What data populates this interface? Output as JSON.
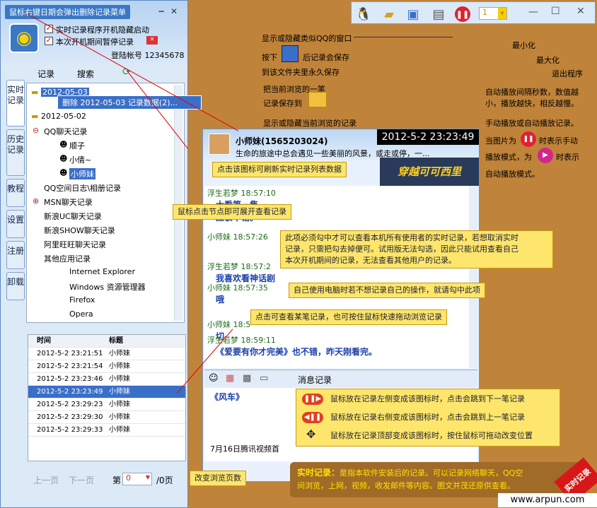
{
  "sidebar": {
    "tooltip_top": "鼠标右键日期会弹出删除记录菜单",
    "options": [
      "实时记录程序开机隐藏启动",
      "本次开机期间暂停记录"
    ],
    "account_label": "登陆帐号 12345678",
    "tabs_top": [
      "记录",
      "搜索"
    ],
    "tabs_side": [
      "实时记录",
      "历史记录",
      "教程",
      "设置",
      "注册",
      "卸载"
    ],
    "context_menu": "删除 2012-05-03 记录数据(2)...",
    "tree": {
      "date1": "2012-05-03",
      "date2": "2012-05-02",
      "qq": "QQ聊天记录",
      "qq_items": [
        "顺子",
        "小倩~",
        "小师妹"
      ],
      "qq_space": "QQ空间日志\\相册记录",
      "msn": "MSN聊天记录",
      "sina_uc": "新浪UC聊天记录",
      "sina_show": "新浪SHOW聊天记录",
      "aliww": "阿里旺旺聊天记录",
      "other": "其他应用记录",
      "other_items": [
        "Internet Explorer",
        "Windows 资源管理器",
        "Firefox",
        "Opera"
      ]
    },
    "table": {
      "headers": [
        "时间",
        "标题"
      ],
      "rows": [
        [
          "2012-5-2 23:21:51",
          "小师妹"
        ],
        [
          "2012-5-2 23:21:54",
          "小师妹"
        ],
        [
          "2012-5-2 23:23:46",
          "小师妹"
        ],
        [
          "2012-5-2 23:23:49",
          "小师妹"
        ],
        [
          "2012-5-2 23:29:23",
          "小师妹"
        ],
        [
          "2012-5-2 23:29:30",
          "小师妹"
        ],
        [
          "2012-5-2 23:29:33",
          "小师妹"
        ]
      ],
      "selected": 3
    },
    "pager": {
      "prev": "上一页",
      "next": "下一页",
      "page_prefix": "第",
      "page_value": "0",
      "page_suffix": "/0页"
    }
  },
  "toolbar": {
    "page_num": "1",
    "labels": {
      "qq_window": "显示或隐藏类似QQ的窗口",
      "save_a": "按下",
      "save_b": "后记录会保存",
      "save_c": "到该文件夹里永久保存",
      "save_cur_a": "把当前浏览的一笔",
      "save_cur_b": "记录保存到",
      "show_hide": "显示或隐藏当前浏览的记录",
      "minimize": "最小化",
      "maximize": "最大化",
      "exit": "退出程序",
      "interval": [
        "自动播放间隔秒数，数值越",
        "小，播放越快，相反越慢。"
      ],
      "manual": [
        "手动播放或自动播放记录。",
        "当图片为",
        "时表示手动",
        "播放模式，为",
        "时表示",
        "自动播放模式。"
      ]
    }
  },
  "chat": {
    "contact": "小师妹(1565203024)",
    "signature": "生命的旅途中总会遇见一些美丽的风景，或走或停，一...",
    "timestamp": "2012-5-2 23:23:49",
    "banner": "穿越可可西里",
    "messages": [
      {
        "name": "浮生若梦",
        "time": "18:57:10",
        "text": "大看第一集。"
      },
      {
        "name": "",
        "time": "",
        "text": "应该不错。"
      },
      {
        "name": "小师妹",
        "time": "18:57:26",
        "text": ""
      },
      {
        "name": "浮生若梦",
        "time": "18:57:2",
        "text": "我喜欢看神话剧"
      },
      {
        "name": "小师妹",
        "time": "18:57:35",
        "text": "哦"
      },
      {
        "name": "小师妹",
        "time": "18:5",
        "text": "切"
      },
      {
        "name": "浮生若梦",
        "time": "18:59:11",
        "text": "《爱要有你才完美》也不错，昨天刚看完。"
      }
    ],
    "toolbar_label": "消息记录",
    "input_text": "《风车》",
    "status": "7月16日腾讯视频首"
  },
  "notes": {
    "refresh": "点击该图标可刷新实时记录列表数据",
    "expand": "鼠标点击节点即可展开查看记录",
    "realtime": [
      "此项必须勾中才可以查看本机所有使用者的实时记录，若想取消实时",
      "记录，只需把勾去掉便可。试用版无法勾选，因此只能试用查看自己",
      "本次开机期间的记录，无法查看其他用户的记录。"
    ],
    "pause": "自己使用电脑时若不想记录自己的操作，就请勾中此项",
    "click_view": "点击可查看某笔记录，也可按住鼠标快速拖动浏览记录",
    "change_page": "改变浏览页数",
    "nav": [
      "鼠标放在记录左侧变成该图标时，点击会跳到下一笔记录",
      "鼠标放在记录右侧变成该图标时，点击会跳到上一笔记录",
      "鼠标放在记录顶部变成该图标时，按住鼠标可拖动改变位置"
    ],
    "footer_title": "实时记录：",
    "footer_body": [
      "是指本软件安装后的记录。可以记录网络聊天，QQ空",
      "间浏览，上网，视频，收发邮件等内容。图文并茂还原供查看。"
    ],
    "corner": "实时记录",
    "site": "www.arpun.com"
  },
  "colors": {
    "accent": "#3a6fc8",
    "note_bg": "#fde66b",
    "bg": "#c0833a"
  }
}
